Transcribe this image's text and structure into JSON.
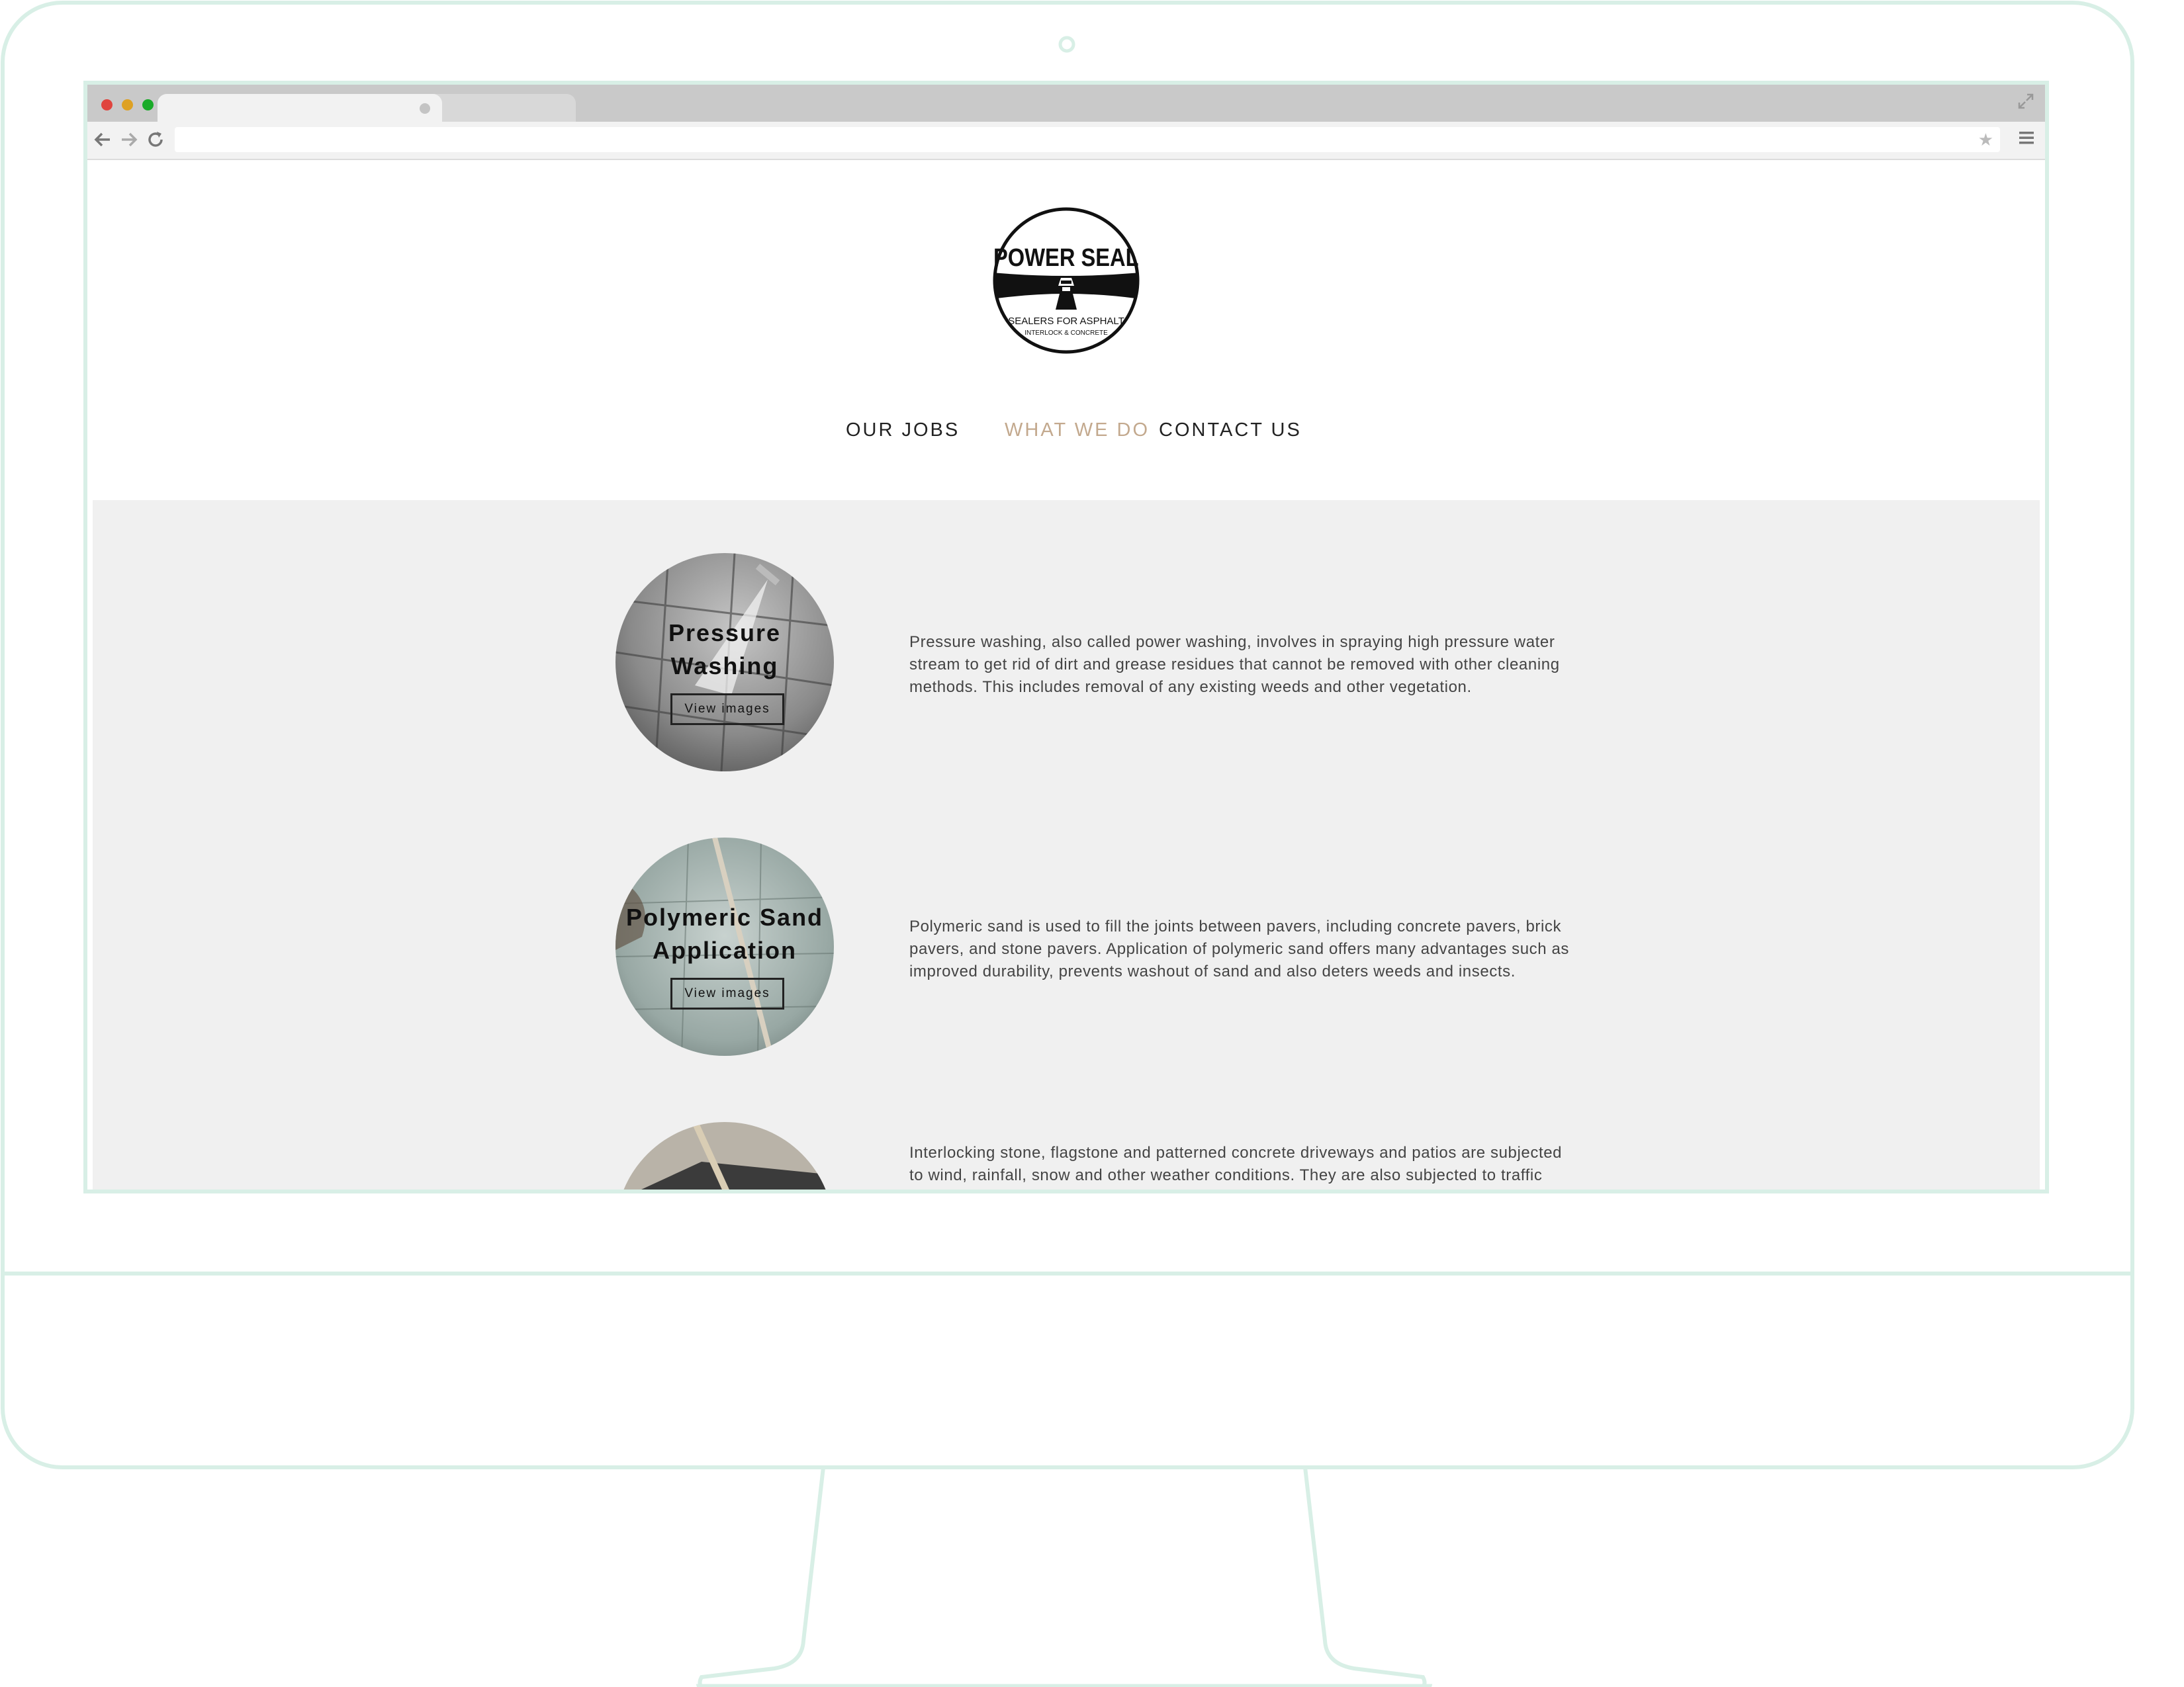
{
  "colors": {
    "frame": "#d8efe6",
    "nav_active": "#c3a98e",
    "content_bg": "#f0f0f0",
    "browser_chrome": "#c9c9c9"
  },
  "browser": {
    "icons": [
      "back-arrow-icon",
      "forward-arrow-icon",
      "reload-icon",
      "star-icon",
      "menu-icon",
      "expand-icon"
    ]
  },
  "logo": {
    "title": "POWER SEAL",
    "line1": "SEALERS FOR ASPHALT",
    "line2": "INTERLOCK & CONCRETE"
  },
  "nav": {
    "items": [
      {
        "label": "OUR JOBS",
        "active": false
      },
      {
        "label": "WHAT WE DO",
        "active": true
      },
      {
        "label": "CONTACT US",
        "active": false
      }
    ]
  },
  "services": [
    {
      "title_line1": "Pressure",
      "title_line2": "Washing",
      "button": "View images",
      "description": "Pressure washing, also called power washing, involves in spraying high pressure water stream to get rid of dirt and grease residues that cannot be removed with other cleaning methods. This includes removal of any existing weeds and other vegetation."
    },
    {
      "title_line1": "Polymeric Sand",
      "title_line2": "Application",
      "button": "View images",
      "description": "Polymeric sand is used to fill the joints between pavers, including concrete pavers, brick pavers, and stone pavers. Application of polymeric sand offers many advantages such as improved durability, prevents washout of sand and also deters weeds and insects."
    },
    {
      "description": "Interlocking stone, flagstone and patterned concrete driveways and patios are subjected to wind, rainfall, snow and other weather conditions. They are also subjected to traffic"
    }
  ]
}
